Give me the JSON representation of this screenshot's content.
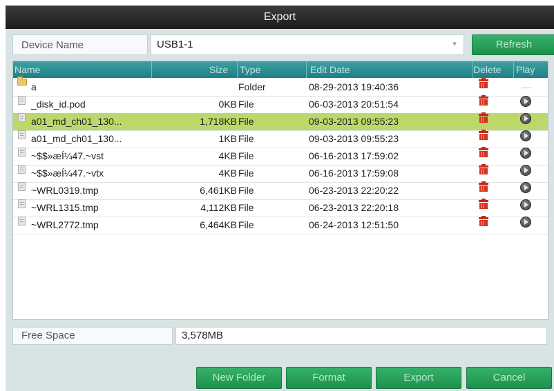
{
  "dialog": {
    "title": "Export"
  },
  "device": {
    "label": "Device Name",
    "value": "USB1-1",
    "refresh_label": "Refresh"
  },
  "columns": {
    "name": "Name",
    "size": "Size",
    "type": "Type",
    "edit_date": "Edit Date",
    "delete": "Delete",
    "play": "Play"
  },
  "files": [
    {
      "name": "a",
      "size": "",
      "type": "Folder",
      "date": "08-29-2013 19:40:36",
      "icon": "folder-icon",
      "playable": false,
      "selected": false
    },
    {
      "name": "_disk_id.pod",
      "size": "0KB",
      "type": "File",
      "date": "06-03-2013 20:51:54",
      "icon": "file-icon",
      "playable": true,
      "selected": false
    },
    {
      "name": "a01_md_ch01_130...",
      "size": "1,718KB",
      "type": "File",
      "date": "09-03-2013 09:55:23",
      "icon": "file-icon",
      "playable": true,
      "selected": true
    },
    {
      "name": "a01_md_ch01_130...",
      "size": "1KB",
      "type": "File",
      "date": "09-03-2013 09:55:23",
      "icon": "file-icon",
      "playable": true,
      "selected": false
    },
    {
      "name": "~$$»æÍ¼47.~vst",
      "size": "4KB",
      "type": "File",
      "date": "06-16-2013 17:59:02",
      "icon": "file-icon",
      "playable": true,
      "selected": false
    },
    {
      "name": "~$$»æÍ¼47.~vtx",
      "size": "4KB",
      "type": "File",
      "date": "06-16-2013 17:59:08",
      "icon": "file-icon",
      "playable": true,
      "selected": false
    },
    {
      "name": "~WRL0319.tmp",
      "size": "6,461KB",
      "type": "File",
      "date": "06-23-2013 22:20:22",
      "icon": "file-icon",
      "playable": true,
      "selected": false
    },
    {
      "name": "~WRL1315.tmp",
      "size": "4,112KB",
      "type": "File",
      "date": "06-23-2013 22:20:18",
      "icon": "file-icon",
      "playable": true,
      "selected": false
    },
    {
      "name": "~WRL2772.tmp",
      "size": "6,464KB",
      "type": "File",
      "date": "06-24-2013 12:51:50",
      "icon": "file-icon",
      "playable": true,
      "selected": false
    }
  ],
  "free_space": {
    "label": "Free Space",
    "value": "3,578MB"
  },
  "buttons": {
    "new_folder": "New Folder",
    "format": "Format",
    "export": "Export",
    "cancel": "Cancel"
  },
  "colors": {
    "title_bar": "#2a2a2a",
    "header": "#2b8c90",
    "button": "#28a35b",
    "selected_row": "#bcd86a",
    "delete_icon": "#d4321f"
  }
}
